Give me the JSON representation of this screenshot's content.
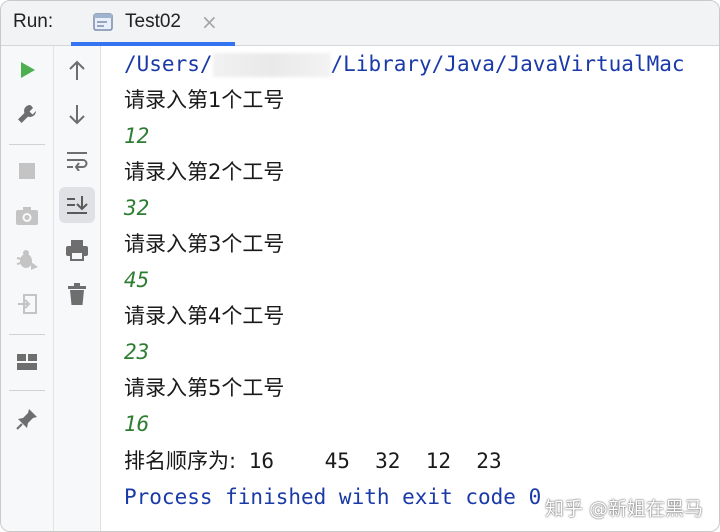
{
  "header": {
    "run_label": "Run:",
    "tab": {
      "title": "Test02",
      "close": "×",
      "icon": "run-config-icon"
    }
  },
  "toolbar_left": [
    {
      "name": "rerun-icon",
      "glyph": "▶",
      "color": "#4caf50"
    },
    {
      "name": "wrench-icon",
      "glyph": "wrench",
      "color": "#6e6e6e"
    },
    {
      "name": "stop-icon",
      "glyph": "■",
      "color": "#c4c4c4"
    },
    {
      "name": "camera-icon",
      "glyph": "camera",
      "color": "#c4c4c4"
    },
    {
      "name": "debug-bug-icon",
      "glyph": "bug",
      "color": "#c4c4c4"
    },
    {
      "name": "exit-icon",
      "glyph": "exit",
      "color": "#c4c4c4"
    },
    {
      "name": "layout-icon",
      "glyph": "layout",
      "color": "#6e6e6e"
    },
    {
      "name": "pin-icon",
      "glyph": "pin",
      "color": "#6e6e6e"
    }
  ],
  "toolbar_right": [
    {
      "name": "up-arrow-icon",
      "glyph": "↑"
    },
    {
      "name": "down-arrow-icon",
      "glyph": "↓"
    },
    {
      "name": "soft-wrap-icon",
      "glyph": "wrap"
    },
    {
      "name": "scroll-to-end-icon",
      "glyph": "scroll-end",
      "active": true
    },
    {
      "name": "print-icon",
      "glyph": "print"
    },
    {
      "name": "trash-icon",
      "glyph": "trash"
    }
  ],
  "console": {
    "path_prefix": "/Users/",
    "path_suffix": "/Library/Java/JavaVirtualMac",
    "lines": [
      {
        "type": "prompt",
        "text": "请录入第1个工号"
      },
      {
        "type": "input",
        "text": "12"
      },
      {
        "type": "prompt",
        "text": "请录入第2个工号"
      },
      {
        "type": "input",
        "text": "32"
      },
      {
        "type": "prompt",
        "text": "请录入第3个工号"
      },
      {
        "type": "input",
        "text": "45"
      },
      {
        "type": "prompt",
        "text": "请录入第4个工号"
      },
      {
        "type": "input",
        "text": "23"
      },
      {
        "type": "prompt",
        "text": "请录入第5个工号"
      },
      {
        "type": "input",
        "text": "16"
      }
    ],
    "result_label": "排名顺序为:",
    "result_values": " 16    45  32  12  23",
    "finish": "Process finished with exit code 0"
  },
  "watermark": "知乎 @新姐在黑马",
  "colors": {
    "accent": "#3574f0",
    "input": "#2f7d32",
    "command": "#1a3aa8"
  }
}
